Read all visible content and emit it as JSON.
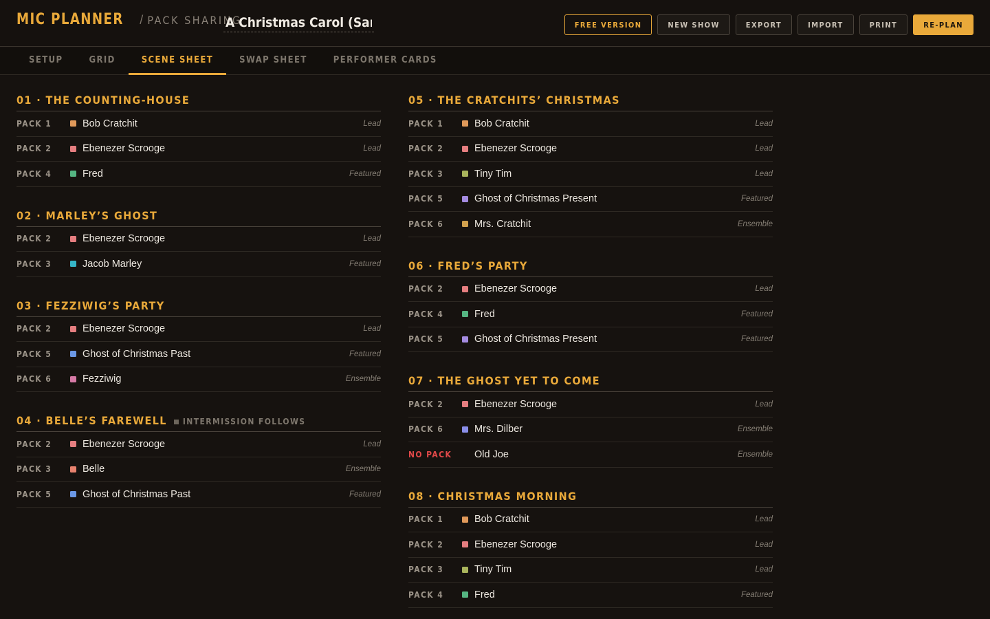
{
  "app": {
    "brand": "MIC PLANNER",
    "separator": "/",
    "subtitle": "PACK SHARING",
    "show_title": "A Christmas Carol (Sample"
  },
  "toolbar": {
    "free_version": "FREE VERSION",
    "new_show": "NEW SHOW",
    "export": "EXPORT",
    "import": "IMPORT",
    "print": "PRINT",
    "replan": "RE-PLAN"
  },
  "tabs": [
    "SETUP",
    "GRID",
    "SCENE SHEET",
    "SWAP SHEET",
    "PERFORMER CARDS"
  ],
  "active_tab": 2,
  "colors": {
    "accent": "#e9a93a",
    "no_pack": "#e04848",
    "bob_cratchit": "#e0995a",
    "ebenezer_scrooge": "#e57e80",
    "fred": "#55b582",
    "jacob_marley": "#35b5c7",
    "ghost_past": "#6b98e6",
    "fezziwig": "#d67aa6",
    "belle": "#e8826e",
    "tiny_tim": "#a9b45c",
    "ghost_present": "#a48be0",
    "mrs_cratchit": "#d1a14e",
    "mrs_dilber": "#8a8ee8"
  },
  "scenes": [
    {
      "title": "01 · THE COUNTING-HOUSE",
      "rows": [
        {
          "pack": "PACK 1",
          "role": "Bob Cratchit",
          "color": "#e0995a",
          "tier": "Lead"
        },
        {
          "pack": "PACK 2",
          "role": "Ebenezer Scrooge",
          "color": "#e57e80",
          "tier": "Lead"
        },
        {
          "pack": "PACK 4",
          "role": "Fred",
          "color": "#55b582",
          "tier": "Featured"
        }
      ]
    },
    {
      "title": "02 · MARLEY’S GHOST",
      "rows": [
        {
          "pack": "PACK 2",
          "role": "Ebenezer Scrooge",
          "color": "#e57e80",
          "tier": "Lead"
        },
        {
          "pack": "PACK 3",
          "role": "Jacob Marley",
          "color": "#35b5c7",
          "tier": "Featured"
        }
      ]
    },
    {
      "title": "03 · FEZZIWIG’S PARTY",
      "rows": [
        {
          "pack": "PACK 2",
          "role": "Ebenezer Scrooge",
          "color": "#e57e80",
          "tier": "Lead"
        },
        {
          "pack": "PACK 5",
          "role": "Ghost of Christmas Past",
          "color": "#6b98e6",
          "tier": "Featured"
        },
        {
          "pack": "PACK 6",
          "role": "Fezziwig",
          "color": "#d67aa6",
          "tier": "Ensemble"
        }
      ]
    },
    {
      "title": "04 · BELLE’S FAREWELL",
      "note": "INTERMISSION FOLLOWS",
      "rows": [
        {
          "pack": "PACK 2",
          "role": "Ebenezer Scrooge",
          "color": "#e57e80",
          "tier": "Lead"
        },
        {
          "pack": "PACK 3",
          "role": "Belle",
          "color": "#e8826e",
          "tier": "Ensemble"
        },
        {
          "pack": "PACK 5",
          "role": "Ghost of Christmas Past",
          "color": "#6b98e6",
          "tier": "Featured"
        }
      ]
    },
    {
      "title": "05 · THE CRATCHITS’ CHRISTMAS",
      "rows": [
        {
          "pack": "PACK 1",
          "role": "Bob Cratchit",
          "color": "#e0995a",
          "tier": "Lead"
        },
        {
          "pack": "PACK 2",
          "role": "Ebenezer Scrooge",
          "color": "#e57e80",
          "tier": "Lead"
        },
        {
          "pack": "PACK 3",
          "role": "Tiny Tim",
          "color": "#a9b45c",
          "tier": "Lead"
        },
        {
          "pack": "PACK 5",
          "role": "Ghost of Christmas Present",
          "color": "#a48be0",
          "tier": "Featured"
        },
        {
          "pack": "PACK 6",
          "role": "Mrs. Cratchit",
          "color": "#d1a14e",
          "tier": "Ensemble"
        }
      ]
    },
    {
      "title": "06 · FRED’S PARTY",
      "rows": [
        {
          "pack": "PACK 2",
          "role": "Ebenezer Scrooge",
          "color": "#e57e80",
          "tier": "Lead"
        },
        {
          "pack": "PACK 4",
          "role": "Fred",
          "color": "#55b582",
          "tier": "Featured"
        },
        {
          "pack": "PACK 5",
          "role": "Ghost of Christmas Present",
          "color": "#a48be0",
          "tier": "Featured"
        }
      ]
    },
    {
      "title": "07 · THE GHOST YET TO COME",
      "rows": [
        {
          "pack": "PACK 2",
          "role": "Ebenezer Scrooge",
          "color": "#e57e80",
          "tier": "Lead"
        },
        {
          "pack": "PACK 6",
          "role": "Mrs. Dilber",
          "color": "#8a8ee8",
          "tier": "Ensemble"
        },
        {
          "pack": "NO PACK",
          "role": "Old Joe",
          "color": "",
          "tier": "Ensemble",
          "no_pack": true
        }
      ]
    },
    {
      "title": "08 · CHRISTMAS MORNING",
      "rows": [
        {
          "pack": "PACK 1",
          "role": "Bob Cratchit",
          "color": "#e0995a",
          "tier": "Lead"
        },
        {
          "pack": "PACK 2",
          "role": "Ebenezer Scrooge",
          "color": "#e57e80",
          "tier": "Lead"
        },
        {
          "pack": "PACK 3",
          "role": "Tiny Tim",
          "color": "#a9b45c",
          "tier": "Lead"
        },
        {
          "pack": "PACK 4",
          "role": "Fred",
          "color": "#55b582",
          "tier": "Featured"
        }
      ]
    }
  ]
}
